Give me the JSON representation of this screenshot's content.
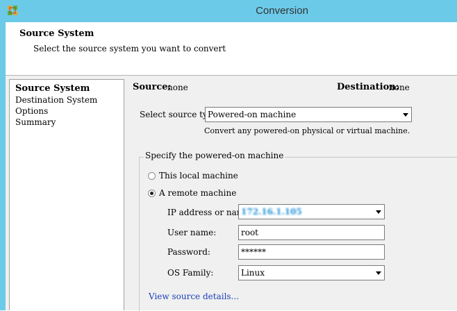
{
  "window": {
    "title": "Conversion"
  },
  "header": {
    "title": "Source System",
    "subtitle": "Select the source system you want to convert"
  },
  "nav": {
    "items": [
      "Source System",
      "Destination System",
      "Options",
      "Summary"
    ],
    "active": "Source System"
  },
  "summary": {
    "source_label": "Source:",
    "source_value": "none",
    "destination_label": "Destination:",
    "destination_value": "none"
  },
  "source_type": {
    "label": "Select source type:",
    "value": "Powered-on machine",
    "description": "Convert any powered-on physical or virtual machine."
  },
  "machine_group": {
    "legend": "Specify the powered-on machine",
    "options": [
      "This local machine",
      "A remote machine"
    ],
    "selected": "A remote machine"
  },
  "fields": {
    "ip_label": "IP address or name:",
    "ip_value": "172.16.1.105",
    "user_label": "User name:",
    "user_value": "root",
    "password_label": "Password:",
    "password_value": "******",
    "os_label": "OS Family:",
    "os_value": "Linux"
  },
  "links": {
    "view_details": "View source details..."
  },
  "colors": {
    "titlebar": "#6ccae9",
    "link": "#1a3fb8",
    "panel": "#f0f0f0"
  }
}
